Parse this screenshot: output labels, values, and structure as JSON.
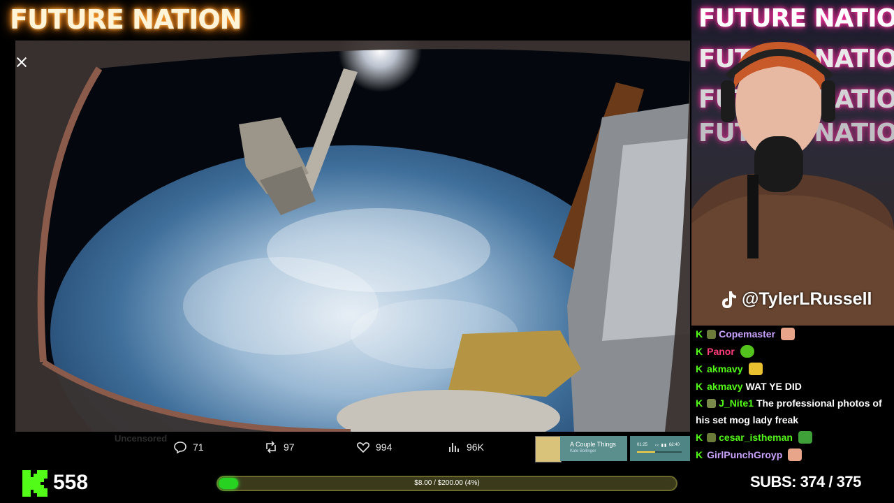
{
  "header": {
    "logo_text": "FUTURE NATION"
  },
  "media": {
    "close_label": "close"
  },
  "tweet": {
    "faded_text": "Uncensored",
    "replies": "71",
    "retweets": "97",
    "likes": "994",
    "views": "96K"
  },
  "music": {
    "song": "A Couple Things",
    "artist": "Kate Bollinger",
    "time_current": "01:25",
    "time_total": "02:40"
  },
  "kick": {
    "viewer_count": "558"
  },
  "goal": {
    "text": "$8.00 / $200.00 (4%)",
    "progress": 0.04
  },
  "subs": {
    "label": "SUBS:",
    "value": "374 / 375"
  },
  "webcam": {
    "logo_text": "FUTURE NATION",
    "tiktok_handle": "@TylerLRussell"
  },
  "chat": {
    "messages": [
      {
        "k": "K",
        "user": "Copemaster",
        "user_color": "#c9a3ff",
        "text": ""
      },
      {
        "k": "K",
        "user": "Panor",
        "user_color": "#ff3d7a",
        "text": ""
      },
      {
        "k": "K",
        "user": "akmavy",
        "user_color": "#53fc18",
        "text": ""
      },
      {
        "k": "K",
        "user": "akmavy",
        "user_color": "#53fc18",
        "text": "WAT YE DID"
      },
      {
        "k": "K",
        "user": "J_Nite1",
        "user_color": "#53fc18",
        "text": "The professional photos of his set mog lady freak"
      },
      {
        "k": "K",
        "user": "cesar_istheman",
        "user_color": "#53fc18",
        "text": ""
      },
      {
        "k": "K",
        "user": "GirlPunchGroyp",
        "user_color": "#c9a3ff",
        "text": ""
      }
    ]
  },
  "colors": {
    "kick_green": "#53fc18",
    "goal_fill": "#27d320"
  }
}
